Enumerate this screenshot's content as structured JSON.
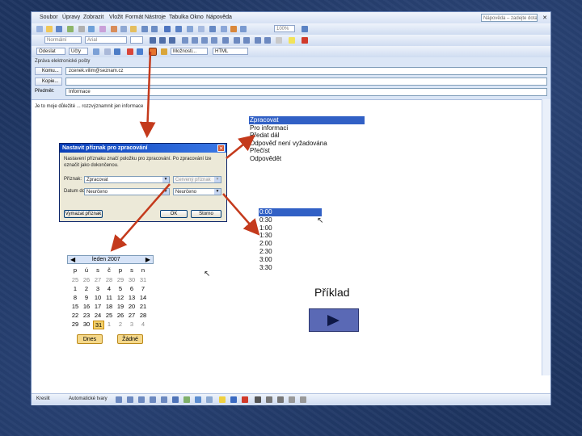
{
  "menu": [
    "Soubor",
    "Úpravy",
    "Zobrazit",
    "Vložit",
    "Formát",
    "Nástroje",
    "Tabulka",
    "Okno",
    "Nápověda"
  ],
  "help_placeholder": "Nápověda – zadejte dotaz",
  "toolbar": {
    "style_dropdown": "Normální",
    "font_dropdown": "Arial",
    "zoom_dropdown": "100%",
    "send_button": "Odeslat",
    "to_dd": "Účty",
    "options_button": "Možnosti...",
    "format_dropdown": "HTML"
  },
  "message": {
    "header_title": "Zpráva elektronické pošty",
    "to_label": "Komu...",
    "to_value": "zcenek.vilim@seznam.cz",
    "cc_label": "Kopie...",
    "subject_label": "Předmět:",
    "subject_value": "Informace",
    "body": "Je to moje důležité ... rozzvýznamnit jen informace"
  },
  "dialog": {
    "title": "Nastavit příznak pro zpracování",
    "description": "Nastavení příznaku značí položku pro zpracování. Po zpracování lze označit jako dokončenou.",
    "flag_label": "Příznak:",
    "flag_value": "Zpracovat",
    "flag_color": "Červený příznak",
    "due_label": "Datum do:",
    "due_date": "Neurčeno",
    "due_time": "Neurčeno",
    "clear_button": "Vymazat příznak",
    "ok_button": "OK",
    "cancel_button": "Storno"
  },
  "flag_options": [
    "Zpracovat",
    "Pro informaci",
    "Předat dál",
    "Odpověď není vyžadována",
    "Přečíst",
    "Odpovědět"
  ],
  "time_options": [
    "0:00",
    "0:30",
    "1:00",
    "1:30",
    "2:00",
    "2:30",
    "3:00",
    "3:30"
  ],
  "calendar": {
    "month": "leden 2007",
    "dow": [
      "p",
      "ú",
      "s",
      "č",
      "p",
      "s",
      "n"
    ],
    "weeks": [
      [
        "25",
        "26",
        "27",
        "28",
        "29",
        "30",
        "31"
      ],
      [
        "1",
        "2",
        "3",
        "4",
        "5",
        "6",
        "7"
      ],
      [
        "8",
        "9",
        "10",
        "11",
        "12",
        "13",
        "14"
      ],
      [
        "15",
        "16",
        "17",
        "18",
        "19",
        "20",
        "21"
      ],
      [
        "22",
        "23",
        "24",
        "25",
        "26",
        "27",
        "28"
      ],
      [
        "29",
        "30",
        "31",
        "1",
        "2",
        "3",
        "4"
      ]
    ],
    "today_button": "Dnes",
    "none_button": "Žádné"
  },
  "drawbar": {
    "draw": "Kreslit",
    "autoshapes": "Automatické tvary"
  },
  "example_label": "Příklad",
  "colors": {
    "slide_bg": "#1e3561",
    "selection": "#3160c5",
    "arrow": "#c43a1c",
    "play_button": "#5a69b5"
  }
}
